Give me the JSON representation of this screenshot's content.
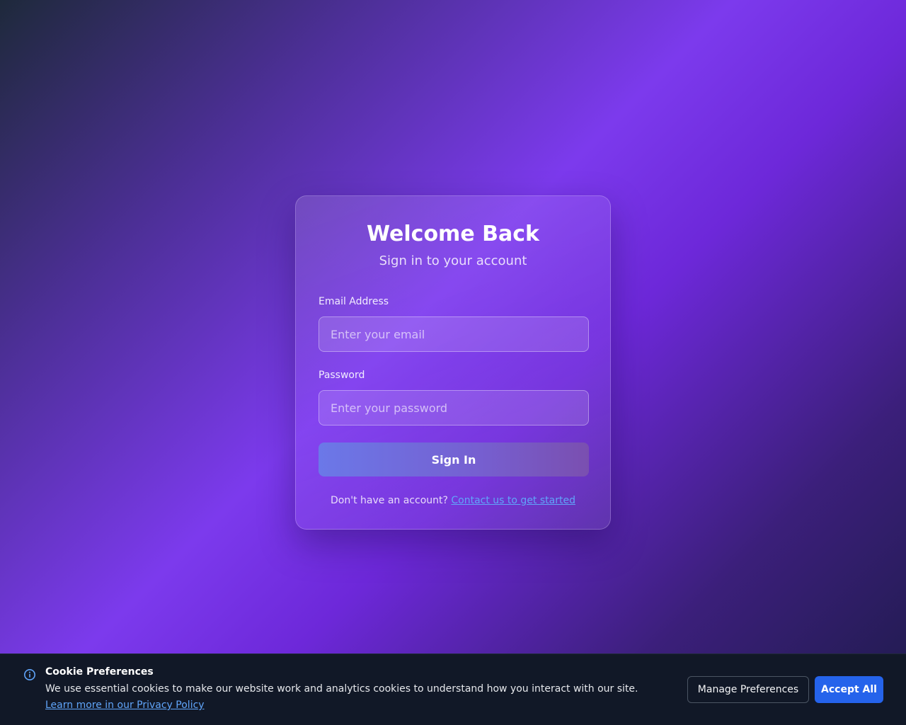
{
  "login": {
    "title": "Welcome Back",
    "subtitle": "Sign in to your account",
    "email_label": "Email Address",
    "email_placeholder": "Enter your email",
    "email_value": "",
    "password_label": "Password",
    "password_placeholder": "Enter your password",
    "password_value": "",
    "submit_label": "Sign In",
    "signup_prompt": "Don't have an account?",
    "signup_link": "Contact us to get started"
  },
  "cookie_banner": {
    "icon": "info-icon",
    "title": "Cookie Preferences",
    "body": "We use essential cookies to make our website work and analytics cookies to understand how you interact with our site.",
    "link": "Learn more in our Privacy Policy",
    "manage_label": "Manage Preferences",
    "accept_label": "Accept All"
  },
  "colors": {
    "accent": "#2563eb",
    "link": "#60a5fa",
    "banner_bg": "#111827",
    "background_mid": "#7c3aed"
  }
}
